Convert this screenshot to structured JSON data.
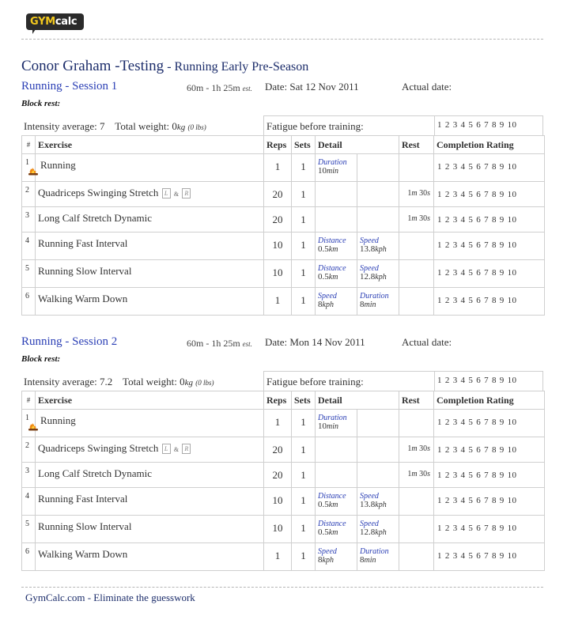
{
  "logo": {
    "gym": "GYM",
    "calc": "calc"
  },
  "title": {
    "main": "Conor Graham -Testing",
    "separator": " - ",
    "program": "Running Early Pre-Season"
  },
  "columns": {
    "hash": "#",
    "exercise": "Exercise",
    "reps": "Reps",
    "sets": "Sets",
    "detail": "Detail",
    "rest": "Rest",
    "completion": "Completion Rating"
  },
  "rating_scale": "1 2 3 4 5 6 7 8 9 10",
  "labels": {
    "est": "est.",
    "date_prefix": "Date: ",
    "actual_date": "Actual date:",
    "block_rest": "Block rest:",
    "intensity_prefix": "Intensity average: ",
    "total_weight_prefix": "Total weight: ",
    "kg_unit": "kg",
    "lbs": "(0 lbs)",
    "fatigue": "Fatigue before training:",
    "lr_left": "L",
    "lr_amp": "&",
    "lr_right": "R"
  },
  "sessions": [
    {
      "name": "Running - Session 1",
      "estimate": "60m - 1h 25m",
      "date": "Sat 12 Nov 2011",
      "intensity_average": "7",
      "total_weight": "0",
      "exercises": [
        {
          "num": "1",
          "name": "Running",
          "warmup_icon": true,
          "reps": "1",
          "sets": "1",
          "detail1": {
            "label": "Duration",
            "value": "10",
            "unit": "min"
          },
          "detail2": null,
          "rest": null
        },
        {
          "num": "2",
          "name": "Quadriceps Swinging Stretch",
          "lr": true,
          "reps": "20",
          "sets": "1",
          "detail1": null,
          "detail2": null,
          "rest": {
            "m": "1",
            "s": "30"
          }
        },
        {
          "num": "3",
          "name": "Long Calf Stretch Dynamic",
          "reps": "20",
          "sets": "1",
          "detail1": null,
          "detail2": null,
          "rest": {
            "m": "1",
            "s": "30"
          }
        },
        {
          "num": "4",
          "name": "Running Fast Interval",
          "reps": "10",
          "sets": "1",
          "detail1": {
            "label": "Distance",
            "value": "0.5",
            "unit": "km"
          },
          "detail2": {
            "label": "Speed",
            "value": "13.8",
            "unit": "kph"
          },
          "rest": null
        },
        {
          "num": "5",
          "name": "Running Slow Interval",
          "reps": "10",
          "sets": "1",
          "detail1": {
            "label": "Distance",
            "value": "0.5",
            "unit": "km"
          },
          "detail2": {
            "label": "Speed",
            "value": "12.8",
            "unit": "kph"
          },
          "rest": null
        },
        {
          "num": "6",
          "name": "Walking Warm Down",
          "reps": "1",
          "sets": "1",
          "detail1": {
            "label": "Speed",
            "value": "8",
            "unit": "kph"
          },
          "detail2": {
            "label": "Duration",
            "value": "8",
            "unit": "min"
          },
          "rest": null
        }
      ]
    },
    {
      "name": "Running - Session 2",
      "estimate": "60m - 1h 25m",
      "date": "Mon 14 Nov 2011",
      "intensity_average": "7.2",
      "total_weight": "0",
      "exercises": [
        {
          "num": "1",
          "name": "Running",
          "warmup_icon": true,
          "reps": "1",
          "sets": "1",
          "detail1": {
            "label": "Duration",
            "value": "10",
            "unit": "min"
          },
          "detail2": null,
          "rest": null
        },
        {
          "num": "2",
          "name": "Quadriceps Swinging Stretch",
          "lr": true,
          "reps": "20",
          "sets": "1",
          "detail1": null,
          "detail2": null,
          "rest": {
            "m": "1",
            "s": "30"
          }
        },
        {
          "num": "3",
          "name": "Long Calf Stretch Dynamic",
          "reps": "20",
          "sets": "1",
          "detail1": null,
          "detail2": null,
          "rest": {
            "m": "1",
            "s": "30"
          }
        },
        {
          "num": "4",
          "name": "Running Fast Interval",
          "reps": "10",
          "sets": "1",
          "detail1": {
            "label": "Distance",
            "value": "0.5",
            "unit": "km"
          },
          "detail2": {
            "label": "Speed",
            "value": "13.8",
            "unit": "kph"
          },
          "rest": null
        },
        {
          "num": "5",
          "name": "Running Slow Interval",
          "reps": "10",
          "sets": "1",
          "detail1": {
            "label": "Distance",
            "value": "0.5",
            "unit": "km"
          },
          "detail2": {
            "label": "Speed",
            "value": "12.8",
            "unit": "kph"
          },
          "rest": null
        },
        {
          "num": "6",
          "name": "Walking Warm Down",
          "reps": "1",
          "sets": "1",
          "detail1": {
            "label": "Speed",
            "value": "8",
            "unit": "kph"
          },
          "detail2": {
            "label": "Duration",
            "value": "8",
            "unit": "min"
          },
          "rest": null
        }
      ]
    }
  ],
  "footer": "GymCalc.com - Eliminate the guesswork"
}
